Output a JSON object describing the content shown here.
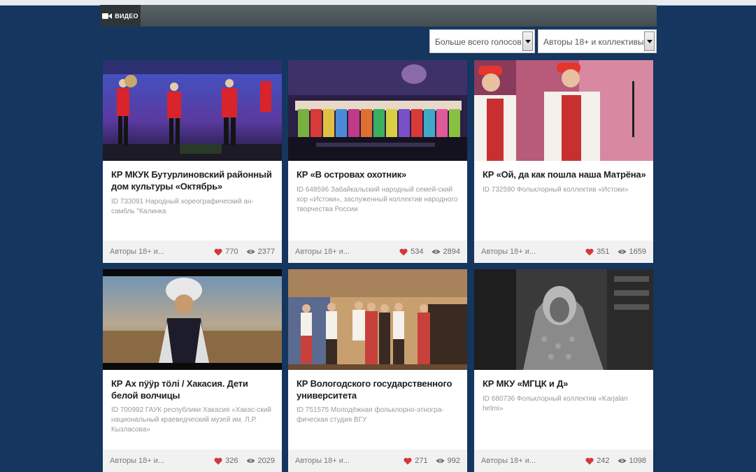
{
  "header": {
    "tab_label": "ВИДЕО",
    "tab_icon": "video-camera-icon"
  },
  "filters": {
    "sort": "Больше всего голосов",
    "category": "Авторы 18+ и коллективы"
  },
  "cards": [
    {
      "title": "КР МКУК Бутурлиновский районный дом культуры «Октябрь»",
      "desc": "ID 733091 Народный хореографический ан-самбль \"Калинка",
      "category": "Авторы 18+ и...",
      "likes": "770",
      "views": "2377"
    },
    {
      "title": "КР «В островах охотник»",
      "desc": "ID 648596 Забайкальский народный семей-ский хор «Истоки», заслуженный коллектив народного творчества России",
      "category": "Авторы 18+ и...",
      "likes": "534",
      "views": "2894"
    },
    {
      "title": "КР «Ой, да как пошла наша Матрёна»",
      "desc": "ID 732590 Фольклорный коллектив «Истоки»",
      "category": "Авторы 18+ и...",
      "likes": "351",
      "views": "1659"
    },
    {
      "title": "КР Ах пӱӱр тöлi / Хакасия. Дети белой волчицы",
      "desc": "ID 700992 ГАУК республики Хакасия «Хакас-ский национальный краеведческий музей им. Л.Р. Кызласова»",
      "category": "Авторы 18+ и...",
      "likes": "326",
      "views": "2029"
    },
    {
      "title": "КР Вологодского государственного университета",
      "desc": "ID 751575 Молодёжная фольклорно-этногра-фическая студия ВГУ",
      "category": "Авторы 18+ и...",
      "likes": "271",
      "views": "992"
    },
    {
      "title": "КР МКУ «МГЦК и Д»",
      "desc": "ID 680736 Фольклорный коллектив «Karjalan helmi»",
      "category": "Авторы 18+ и...",
      "likes": "242",
      "views": "1098"
    }
  ],
  "colors": {
    "page_bg": "#14365f",
    "heart": "#d0393b"
  }
}
